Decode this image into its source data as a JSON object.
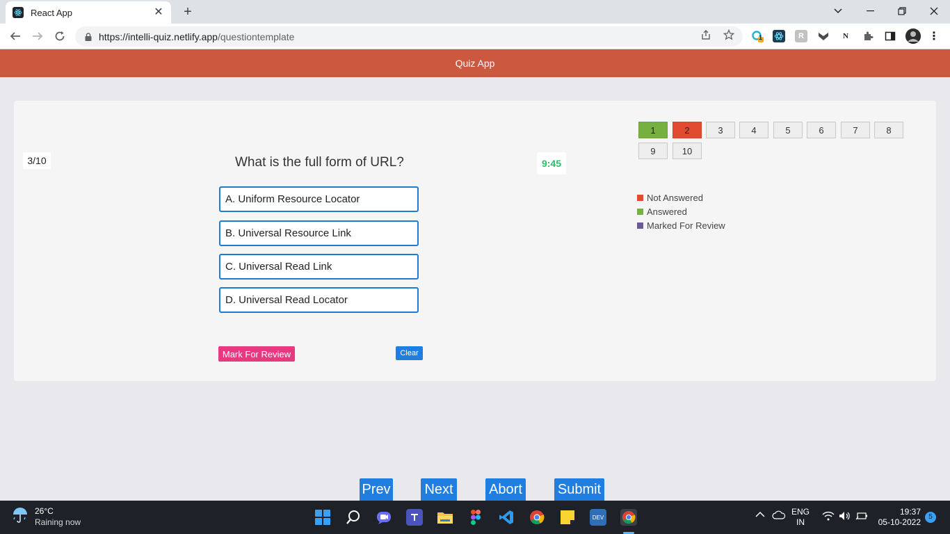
{
  "browser": {
    "tab_title": "React App",
    "url_host": "https://intelli-quiz.netlify.app",
    "url_path": "/questiontemplate",
    "ext_badge": "1",
    "ext_letters": {
      "r": "R",
      "n": "N"
    }
  },
  "app": {
    "header_title": "Quiz App"
  },
  "quiz": {
    "progress": "3/10",
    "question": "What is the full form of URL?",
    "timer": "9:45",
    "options": [
      {
        "label": "A. Uniform Resource Locator"
      },
      {
        "label": "B. Universal Resource Link"
      },
      {
        "label": "C. Universal Read Link"
      },
      {
        "label": "D. Universal Read Locator"
      }
    ],
    "mark_review_label": "Mark For Review",
    "clear_label": "Clear",
    "palette": [
      {
        "num": "1",
        "status": "answered"
      },
      {
        "num": "2",
        "status": "not-answered"
      },
      {
        "num": "3",
        "status": "unvisited"
      },
      {
        "num": "4",
        "status": "unvisited"
      },
      {
        "num": "5",
        "status": "unvisited"
      },
      {
        "num": "6",
        "status": "unvisited"
      },
      {
        "num": "7",
        "status": "unvisited"
      },
      {
        "num": "8",
        "status": "unvisited"
      },
      {
        "num": "9",
        "status": "unvisited"
      },
      {
        "num": "10",
        "status": "unvisited"
      }
    ],
    "legend": [
      {
        "label": "Not Answered",
        "color": "#e24b2f"
      },
      {
        "label": "Answered",
        "color": "#76b041"
      },
      {
        "label": "Marked For Review",
        "color": "#6b5b95"
      }
    ],
    "nav": {
      "prev": "Prev",
      "next": "Next",
      "abort": "Abort",
      "submit": "Submit"
    }
  },
  "taskbar": {
    "temperature": "26°C",
    "weather": "Raining now",
    "lang_top": "ENG",
    "lang_bottom": "IN",
    "time": "19:37",
    "date": "05-10-2022",
    "notifications": "5",
    "dev_label": "DEV"
  },
  "colors": {
    "header": "#cc5840",
    "accent_blue": "#1f7ee0",
    "review_pink": "#e63980",
    "timer_green": "#2bbf6c"
  }
}
